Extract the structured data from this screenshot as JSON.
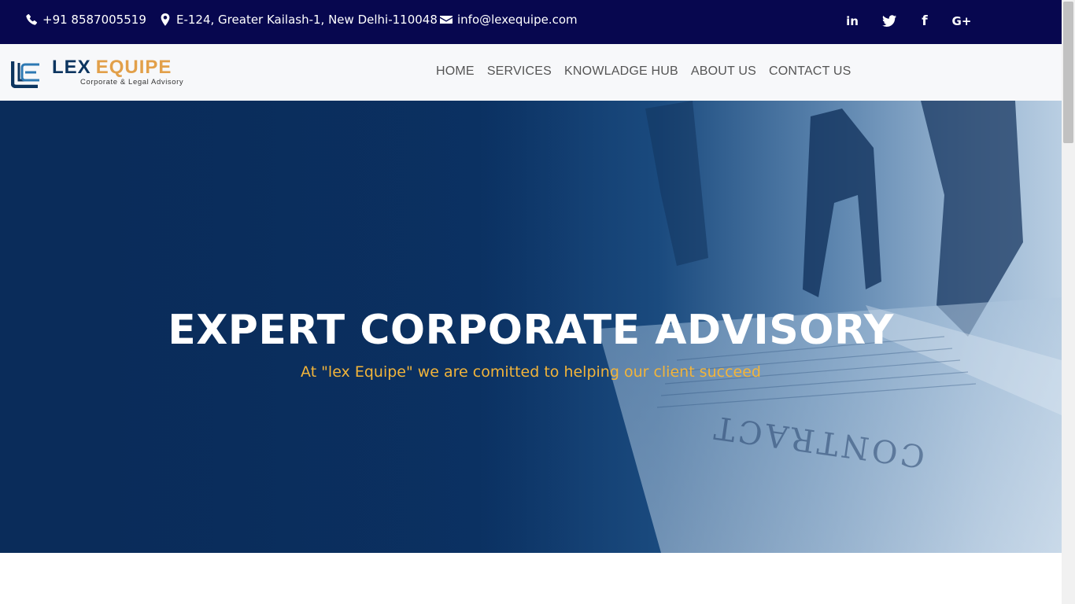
{
  "topbar": {
    "phone": "+91 8587005519",
    "address": "E-124, Greater Kailash-1, New Delhi-110048",
    "email": "info@lexequipe.com",
    "social": [
      {
        "icon": "linkedin-icon",
        "label": "in"
      },
      {
        "icon": "twitter-icon",
        "label": ""
      },
      {
        "icon": "facebook-icon",
        "label": "f"
      },
      {
        "icon": "google-plus-icon",
        "label": "G+"
      }
    ]
  },
  "brand": {
    "name_part1": "LEX",
    "name_part2": "EQUIPE",
    "tagline": "Corporate & Legal Advisory"
  },
  "nav": {
    "items": [
      "HOME",
      "SERVICES",
      "KNOWLADGE HUB",
      "ABOUT US",
      "CONTACT US"
    ]
  },
  "hero": {
    "title": "EXPERT CORPORATE ADVISORY",
    "subtitle": "At \"lex Equipe\" we are comitted to helping our client succeed",
    "background_text": "CONTRACT"
  },
  "colors": {
    "topbar_bg": "#07074f",
    "navbar_bg": "#f7f8fa",
    "brand_blue": "#0c3560",
    "brand_gold": "#e2a04a",
    "hero_subtitle": "#f2b43a"
  }
}
